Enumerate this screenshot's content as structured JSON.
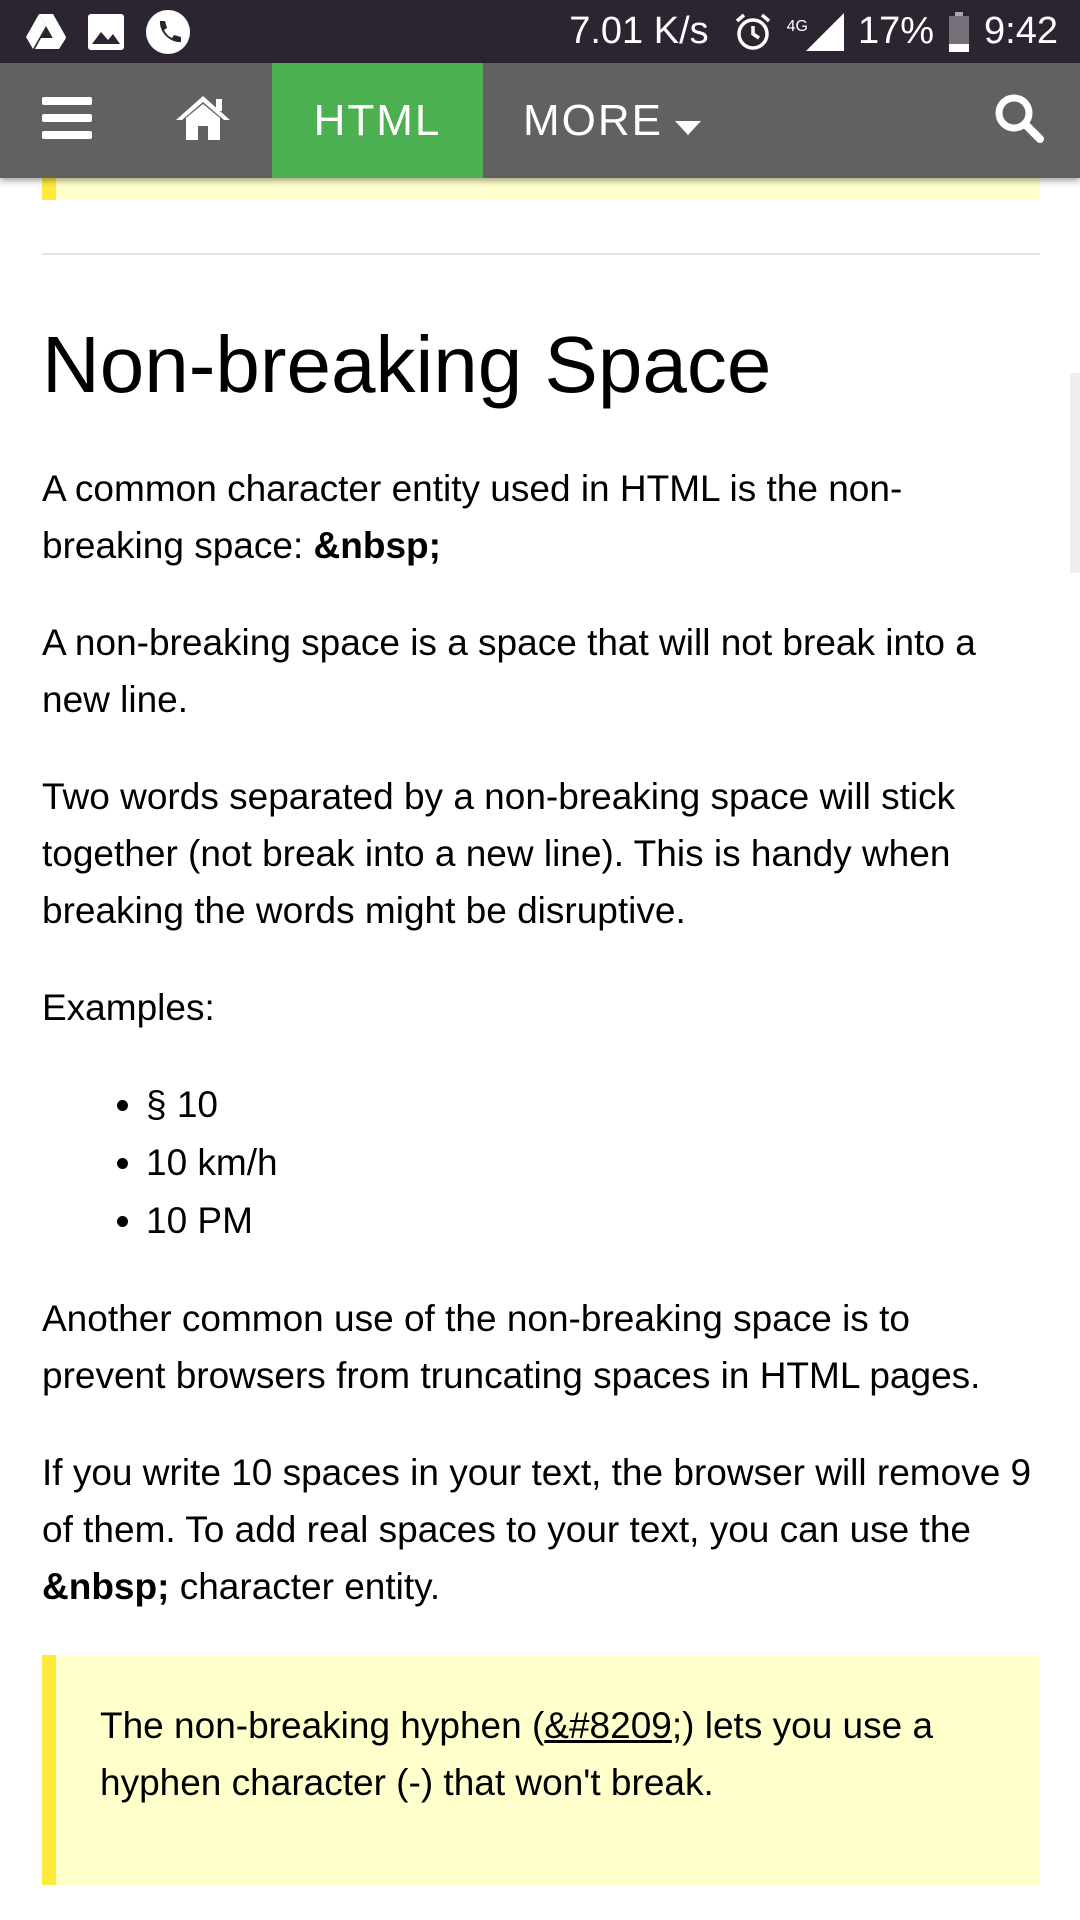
{
  "status_bar": {
    "net_speed": "7.01 K/s",
    "network": "4G",
    "battery": "17%",
    "time": "9:42",
    "icons": [
      "drive-icon",
      "gallery-icon",
      "phone-icon",
      "alarm-icon",
      "signal-icon",
      "battery-icon"
    ]
  },
  "navbar": {
    "html_label": "HTML",
    "more_label": "MORE",
    "icons": [
      "menu-icon",
      "home-icon",
      "caret-down-icon",
      "search-icon"
    ],
    "colors": {
      "bar": "#616161",
      "active_tab": "#4caf50"
    }
  },
  "article": {
    "title": "Non-breaking Space",
    "p1_text": "A common character entity used in HTML is the non-breaking space: ",
    "p1_bold": "&nbsp;",
    "p2": "A non-breaking space is a space that will not break into a new line.",
    "p3": "Two words separated by a non-breaking space will stick together (not break into a new line). This is handy when breaking the words might be disruptive.",
    "examples_label": "Examples:",
    "examples": [
      "§ 10",
      "10 km/h",
      "10 PM"
    ],
    "p4": "Another common use of the non-breaking space is to prevent browsers from truncating spaces in HTML pages.",
    "p5_text": "If you write 10 spaces in your text, the browser will remove 9 of them. To add real spaces to your text, you can use the ",
    "p5_bold": "&nbsp;",
    "p5_end": " character entity.",
    "note_pre": "The non-breaking hyphen (",
    "note_code": "&#8209",
    "note_post": ";) lets you use a hyphen character (-) that won't break."
  },
  "colors": {
    "note_bg": "#ffffcc",
    "note_border": "#ffeb3b",
    "status_bar": "#2c2430"
  }
}
